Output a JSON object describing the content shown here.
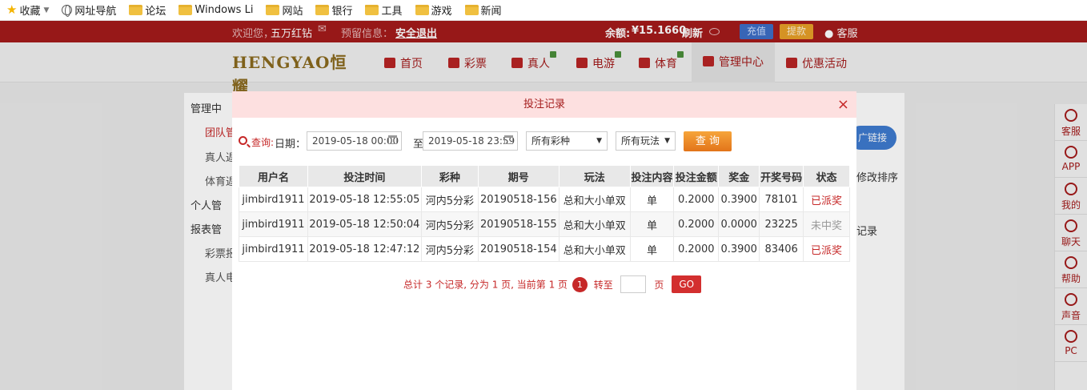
{
  "bookmarks": {
    "items": [
      {
        "label": "收藏",
        "icon": "star-icon"
      },
      {
        "label": "网址导航",
        "icon": "globe-icon"
      },
      {
        "label": "论坛",
        "icon": "folder-icon"
      },
      {
        "label": "Windows Li",
        "icon": "folder-icon"
      },
      {
        "label": "网站",
        "icon": "folder-icon"
      },
      {
        "label": "银行",
        "icon": "folder-icon"
      },
      {
        "label": "工具",
        "icon": "folder-icon"
      },
      {
        "label": "游戏",
        "icon": "folder-icon"
      },
      {
        "label": "新闻",
        "icon": "folder-icon"
      }
    ]
  },
  "topbar": {
    "welcome": "欢迎您，",
    "username": "五万红钻",
    "notice_label": "预留信息：",
    "logout": "安全退出",
    "balance_label": "余额:",
    "balance_value": "¥15.1660",
    "refresh": "刷新",
    "recharge": "充值",
    "withdraw": "提款",
    "service": "客服"
  },
  "nav": {
    "logo": "HENGYAO恒耀",
    "items": [
      {
        "label": "首页"
      },
      {
        "label": "彩票"
      },
      {
        "label": "真人"
      },
      {
        "label": "电游"
      },
      {
        "label": "体育"
      },
      {
        "label": "管理中心"
      },
      {
        "label": "优惠活动"
      }
    ]
  },
  "background": {
    "side": [
      "管理中",
      "团队管",
      "真人返",
      "体育返",
      "个人管",
      "报表管",
      "彩票报",
      "真人电"
    ],
    "right_btn": "广链接",
    "right_text1": "修改排序",
    "right_text2": "记录"
  },
  "right_bar": {
    "items": [
      "客服",
      "APP",
      "我的",
      "聊天",
      "帮助",
      "声音",
      "PC"
    ]
  },
  "modal": {
    "title": "投注记录",
    "close": "×",
    "query_label": "查询:",
    "date_label": "日期：",
    "date_from": "2019-05-18 00:00",
    "to_label": "至",
    "date_to": "2019-05-18 23:59",
    "lottery_select": "所有彩种",
    "play_select": "所有玩法",
    "query_button": "查 询",
    "columns": [
      "用户名",
      "投注时间",
      "彩种",
      "期号",
      "玩法",
      "投注内容",
      "投注金额",
      "奖金",
      "开奖号码",
      "状态"
    ],
    "rows": [
      {
        "user": "jimbird1911",
        "time": "2019-05-18 12:55:05",
        "lottery": "河内5分彩",
        "issue": "20190518-156",
        "play": "总和大小单双",
        "content": "单",
        "amount": "0.2000",
        "prize": "0.3900",
        "number": "78101",
        "status": "已派奖",
        "status_type": "win"
      },
      {
        "user": "jimbird1911",
        "time": "2019-05-18 12:50:04",
        "lottery": "河内5分彩",
        "issue": "20190518-155",
        "play": "总和大小单双",
        "content": "单",
        "amount": "0.2000",
        "prize": "0.0000",
        "number": "23225",
        "status": "未中奖",
        "status_type": "lose"
      },
      {
        "user": "jimbird1911",
        "time": "2019-05-18 12:47:12",
        "lottery": "河内5分彩",
        "issue": "20190518-154",
        "play": "总和大小单双",
        "content": "单",
        "amount": "0.2000",
        "prize": "0.3900",
        "number": "83406",
        "status": "已派奖",
        "status_type": "win"
      }
    ],
    "pager": {
      "summary": "总计 3 个记录, 分为 1 页, 当前第 1 页",
      "current": "1",
      "goto_label": "转至",
      "page_label": "页",
      "go": "GO"
    }
  }
}
